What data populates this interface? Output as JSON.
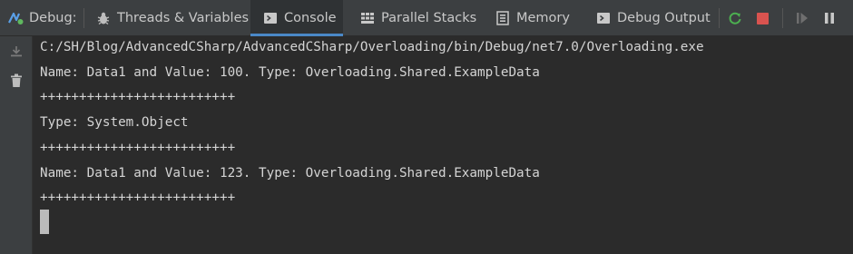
{
  "toolbar": {
    "debug_label": "Debug:",
    "tabs": [
      {
        "label": "Threads & Variables"
      },
      {
        "label": "Console"
      },
      {
        "label": "Parallel Stacks"
      },
      {
        "label": "Memory"
      },
      {
        "label": "Debug Output"
      }
    ],
    "active_tab": "Console",
    "actions": [
      {
        "icon": "rerun-icon"
      },
      {
        "icon": "stop-icon"
      },
      {
        "icon": "resume-icon"
      },
      {
        "icon": "pause-icon"
      }
    ]
  },
  "sidebar": {
    "icons": [
      {
        "icon": "scroll-to-end-icon"
      },
      {
        "icon": "trash-icon"
      }
    ]
  },
  "console": {
    "lines": [
      "C:/SH/Blog/AdvancedCSharp/AdvancedCSharp/Overloading/bin/Debug/net7.0/Overloading.exe",
      "Name: Data1 and Value: 100. Type: Overloading.Shared.ExampleData",
      "+++++++++++++++++++++++++",
      "Type: System.Object",
      "+++++++++++++++++++++++++",
      "Name: Data1 and Value: 123. Type: Overloading.Shared.ExampleData",
      "+++++++++++++++++++++++++"
    ]
  },
  "colors": {
    "background": "#2b2b2b",
    "toolbar": "#3c3f41",
    "text": "#d4d4d4",
    "accent": "#4a88c7",
    "rerun": "#4caf50",
    "stop": "#d9534f"
  }
}
